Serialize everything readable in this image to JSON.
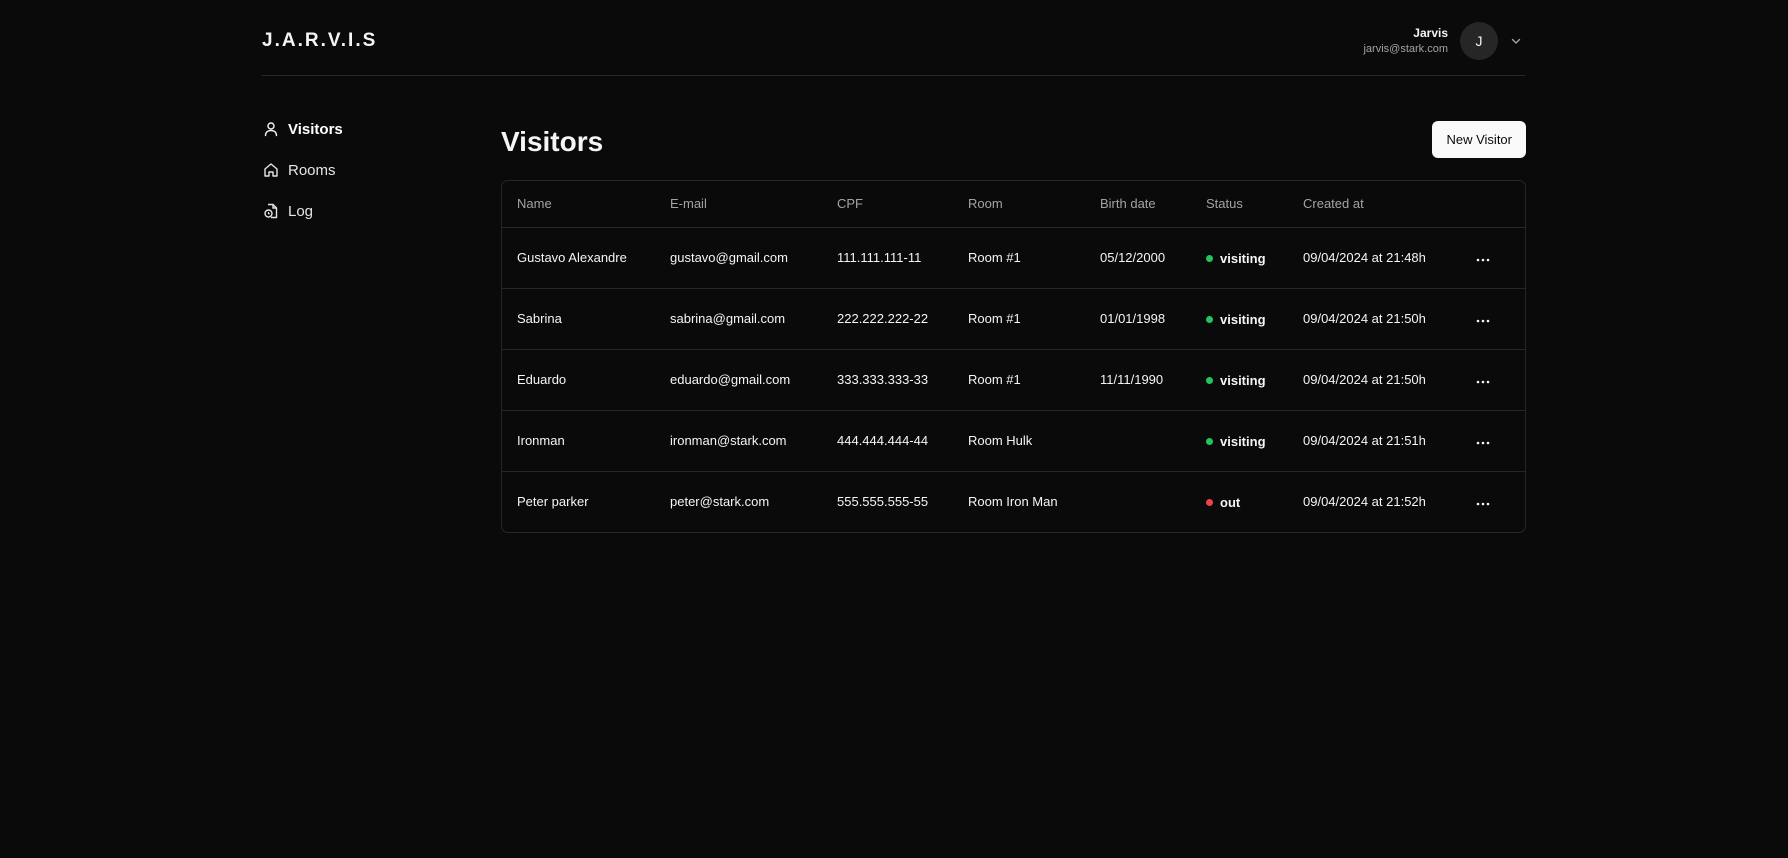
{
  "app": {
    "logo": "J.A.R.V.I.S"
  },
  "user": {
    "name": "Jarvis",
    "email": "jarvis@stark.com",
    "initial": "J"
  },
  "sidebar": {
    "items": [
      {
        "label": "Visitors",
        "icon": "user-icon"
      },
      {
        "label": "Rooms",
        "icon": "home-icon"
      },
      {
        "label": "Log",
        "icon": "file-clock-icon"
      }
    ]
  },
  "main": {
    "title": "Visitors",
    "new_button": "New Visitor"
  },
  "table": {
    "headers": [
      "Name",
      "E-mail",
      "CPF",
      "Room",
      "Birth date",
      "Status",
      "Created at"
    ],
    "rows": [
      {
        "name": "Gustavo Alexandre",
        "email": "gustavo@gmail.com",
        "cpf": "111.111.111-11",
        "room": "Room #1",
        "birth": "05/12/2000",
        "status": "visiting",
        "created": "09/04/2024 at 21:48h"
      },
      {
        "name": "Sabrina",
        "email": "sabrina@gmail.com",
        "cpf": "222.222.222-22",
        "room": "Room #1",
        "birth": "01/01/1998",
        "status": "visiting",
        "created": "09/04/2024 at 21:50h"
      },
      {
        "name": "Eduardo",
        "email": "eduardo@gmail.com",
        "cpf": "333.333.333-33",
        "room": "Room #1",
        "birth": "11/11/1990",
        "status": "visiting",
        "created": "09/04/2024 at 21:50h"
      },
      {
        "name": "Ironman",
        "email": "ironman@stark.com",
        "cpf": "444.444.444-44",
        "room": "Room Hulk",
        "birth": "",
        "status": "visiting",
        "created": "09/04/2024 at 21:51h"
      },
      {
        "name": "Peter parker",
        "email": "peter@stark.com",
        "cpf": "555.555.555-55",
        "room": "Room Iron Man",
        "birth": "",
        "status": "out",
        "created": "09/04/2024 at 21:52h"
      }
    ],
    "more_icon": "ellipsis-icon"
  },
  "colors": {
    "background": "#0a0a0a",
    "border": "#262626",
    "status_visiting": "#22c55e",
    "status_out": "#ef4444"
  }
}
